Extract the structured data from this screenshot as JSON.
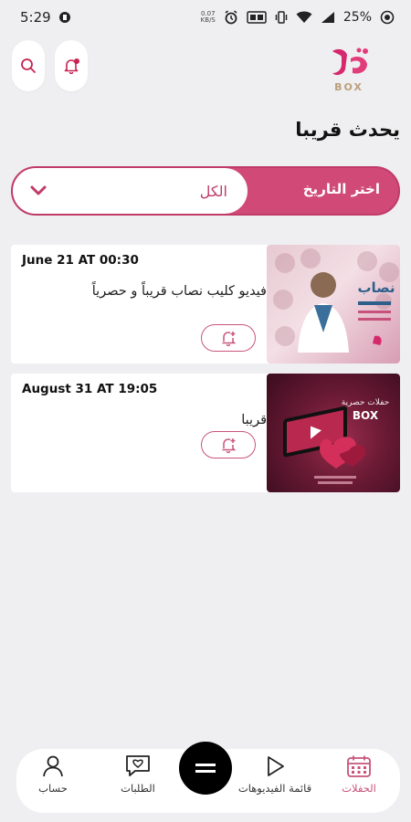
{
  "status_bar": {
    "time": "5:29",
    "net_speed_value": "0.07",
    "net_speed_unit": "KB/S",
    "battery": "25%"
  },
  "header": {
    "logo_text": "BOX"
  },
  "page": {
    "title": "يحدث قريبا"
  },
  "filter": {
    "label": "اختر التاريخ",
    "selected": "الكل"
  },
  "cards": [
    {
      "date": "June 21 AT 00:30",
      "title": "فيديو كليب نصاب قريباً و حصرياً"
    },
    {
      "date": "August 31 AT 19:05",
      "title": "قريبا"
    }
  ],
  "nav": {
    "account": "حساب",
    "requests": "الطلبات",
    "videos": "قائمة الفيديوهات",
    "events": "الحفلات"
  },
  "colors": {
    "accent": "#c8537c",
    "accent_dark": "#c03b68",
    "background": "#efeff1"
  }
}
